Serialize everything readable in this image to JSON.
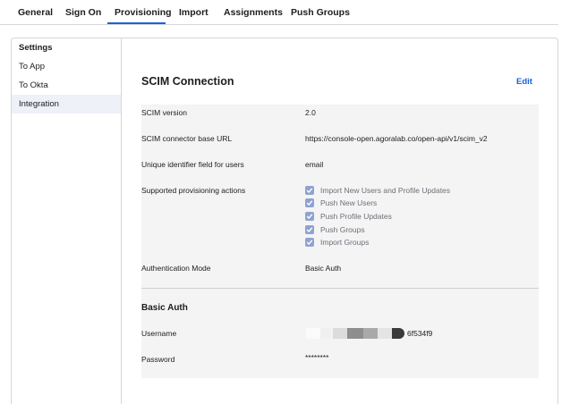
{
  "tabs": [
    {
      "label": "General"
    },
    {
      "label": "Sign On"
    },
    {
      "label": "Provisioning"
    },
    {
      "label": "Import"
    },
    {
      "label": "Assignments"
    },
    {
      "label": "Push Groups"
    }
  ],
  "active_tab": "Provisioning",
  "sidebar": {
    "heading": "Settings",
    "items": [
      {
        "label": "To App"
      },
      {
        "label": "To Okta"
      },
      {
        "label": "Integration"
      }
    ],
    "active_item": "Integration"
  },
  "scim": {
    "title": "SCIM Connection",
    "edit_label": "Edit",
    "rows": {
      "version_label": "SCIM version",
      "version_value": "2.0",
      "base_url_label": "SCIM connector base URL",
      "base_url_value": "https://console-open.agoralab.co/open-api/v1/scim_v2",
      "uid_label": "Unique identifier field for users",
      "uid_value": "email",
      "actions_label": "Supported provisioning actions",
      "auth_mode_label": "Authentication Mode",
      "auth_mode_value": "Basic Auth"
    },
    "actions": [
      {
        "label": "Import New Users and Profile Updates",
        "checked": true
      },
      {
        "label": "Push New Users",
        "checked": true
      },
      {
        "label": "Push Profile Updates",
        "checked": true
      },
      {
        "label": "Push Groups",
        "checked": true
      },
      {
        "label": "Import Groups",
        "checked": true
      }
    ]
  },
  "basic_auth": {
    "title": "Basic Auth",
    "username_label": "Username",
    "username_visible_suffix": "6f534f9",
    "password_label": "Password",
    "password_value": "********"
  },
  "colors": {
    "accent": "#1662dd",
    "checkbox": "#8fa2d1",
    "panel_bg": "#f4f4f4",
    "sidebar_active": "#eef1f8"
  }
}
